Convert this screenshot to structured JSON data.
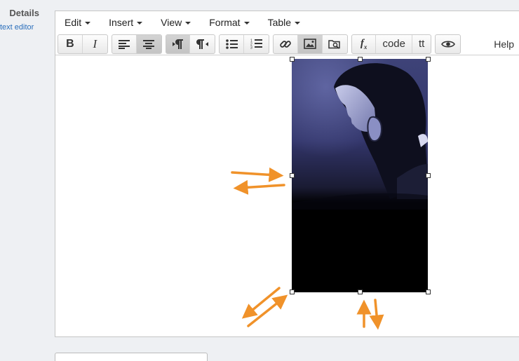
{
  "sidebar": {
    "title": "Details",
    "link": "text editor"
  },
  "menubar": {
    "items": [
      "Edit",
      "Insert",
      "View",
      "Format",
      "Table"
    ]
  },
  "toolbar": {
    "bold": "B",
    "italic": "I",
    "code_label": "code",
    "tt_label": "tt",
    "help_label": "Help"
  },
  "colors": {
    "arrow": "#f0922a",
    "image_tint": "#5a5f9c"
  }
}
